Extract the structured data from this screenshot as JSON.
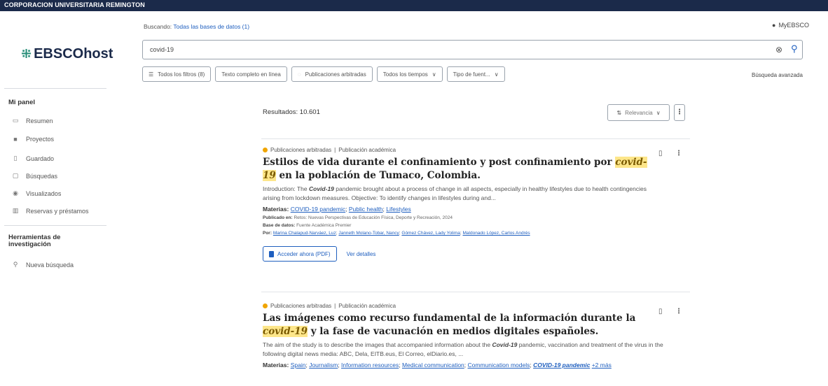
{
  "banner": "CORPORACION UNIVERSITARIA REMINGTON",
  "sidebar": {
    "logo_mark": "⁜",
    "logo_text": "EBSCOhost",
    "panel_heading": "Mi panel",
    "items": [
      {
        "label": "Resumen",
        "icon": "summary-icon"
      },
      {
        "label": "Proyectos",
        "icon": "folder-icon"
      },
      {
        "label": "Guardado",
        "icon": "bookmark-icon"
      },
      {
        "label": "Búsquedas",
        "icon": "searches-icon"
      },
      {
        "label": "Visualizados",
        "icon": "eye-icon"
      },
      {
        "label": "Reservas y préstamos",
        "icon": "library-icon"
      }
    ],
    "tools_heading_1": "Herramientas de",
    "tools_heading_2": "investigación",
    "tools_items": [
      {
        "label": "Nueva búsqueda",
        "icon": "search-icon"
      }
    ]
  },
  "header": {
    "searching_label": "Buscando:",
    "searching_db": "Todas las bases de datos (1)",
    "myebsco": "MyEBSCO",
    "search_value": "covid-19",
    "filters": [
      "Todos los filtros (8)",
      "Texto completo en línea",
      "Publicaciones arbitradas",
      "Todos los tiempos",
      "Tipo de fuent..."
    ],
    "advanced": "Búsqueda avanzada"
  },
  "results": {
    "count": "Resultados: 10.601",
    "sort_label": "Relevancia"
  },
  "records": [
    {
      "type_a": "Publicaciones arbitradas",
      "type_b": "Publicación académica",
      "title_pre": "Estilos de vida durante el confinamiento y post confinamiento por ",
      "title_hl": "covid-19",
      "title_post": " en la población de Tumaco, Colombia.",
      "abstract_pre": "Introduction: The ",
      "abstract_hl": "Covid-19",
      "abstract_post": " pandemic brought about a process of change in all aspects, especially in healthy lifestyles due to health contingencies arising from lockdown measures. Objective: To identify changes in lifestyles during and...",
      "subjects_label": "Materias:",
      "subjects": [
        "COVID-19 pandemic",
        "Public health",
        "Lifestyles"
      ],
      "published_label": "Publicado en:",
      "published": "Retos: Nuevas Perspectivas de Educación Física, Deporte y Recreación, 2024",
      "database_label": "Base de datos:",
      "database": "Fuente Académica Premier",
      "by_label": "Por:",
      "authors": [
        "Marina Chalapud-Narváez, Luz",
        "Janneth Molano-Tobar, Nancy",
        "Gómez Chávez, Lady Yolima",
        "Maldonado López, Carlos Andrés"
      ],
      "pdf_label": "Acceder ahora (PDF)",
      "details_label": "Ver detalles"
    },
    {
      "type_a": "Publicaciones arbitradas",
      "type_b": "Publicación académica",
      "title_pre": "Las imágenes como recurso fundamental de la información durante la ",
      "title_hl": "covid-19",
      "title_post": " y la fase de vacunación en medios digitales españoles.",
      "abstract_pre": "The aim of the study is to describe the images that accompanied information about the ",
      "abstract_hl": "Covid-19",
      "abstract_post": " pandemic, vaccination and treatment of the virus in the following digital news media: ABC, Dela, EITB.eus, El Correo, elDiario.es, ...",
      "subjects_label": "Materias:",
      "subjects": [
        "Spain",
        "Journalism",
        "Information resources",
        "Medical communication",
        "Communication models",
        "COVID-19 pandemic",
        "+2 más"
      ]
    }
  ]
}
